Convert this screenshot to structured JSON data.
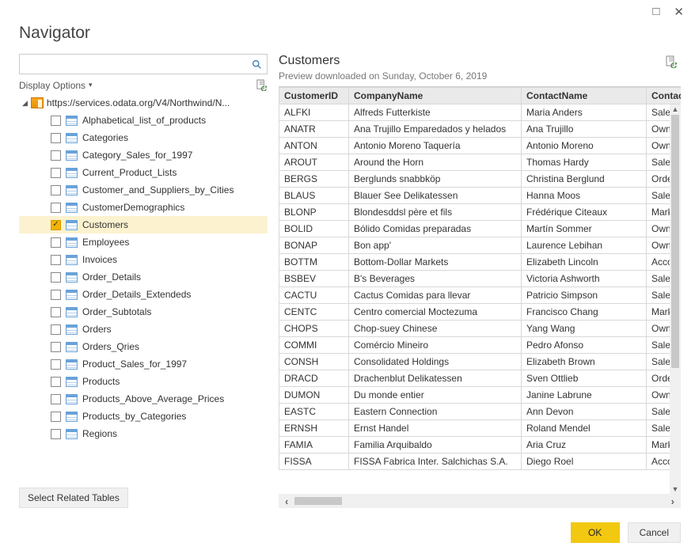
{
  "window": {
    "title": "Navigator"
  },
  "search": {
    "placeholder": ""
  },
  "displayOptions": {
    "label": "Display Options"
  },
  "tree": {
    "root": "https://services.odata.org/V4/Northwind/N...",
    "items": [
      {
        "label": "Alphabetical_list_of_products",
        "checked": false
      },
      {
        "label": "Categories",
        "checked": false
      },
      {
        "label": "Category_Sales_for_1997",
        "checked": false
      },
      {
        "label": "Current_Product_Lists",
        "checked": false
      },
      {
        "label": "Customer_and_Suppliers_by_Cities",
        "checked": false
      },
      {
        "label": "CustomerDemographics",
        "checked": false
      },
      {
        "label": "Customers",
        "checked": true
      },
      {
        "label": "Employees",
        "checked": false
      },
      {
        "label": "Invoices",
        "checked": false
      },
      {
        "label": "Order_Details",
        "checked": false
      },
      {
        "label": "Order_Details_Extendeds",
        "checked": false
      },
      {
        "label": "Order_Subtotals",
        "checked": false
      },
      {
        "label": "Orders",
        "checked": false
      },
      {
        "label": "Orders_Qries",
        "checked": false
      },
      {
        "label": "Product_Sales_for_1997",
        "checked": false
      },
      {
        "label": "Products",
        "checked": false
      },
      {
        "label": "Products_Above_Average_Prices",
        "checked": false
      },
      {
        "label": "Products_by_Categories",
        "checked": false
      },
      {
        "label": "Regions",
        "checked": false
      }
    ]
  },
  "selectRelated": "Select Related Tables",
  "preview": {
    "title": "Customers",
    "sub": "Preview downloaded on Sunday, October 6, 2019",
    "columns": [
      "CustomerID",
      "CompanyName",
      "ContactName",
      "ContactTi"
    ],
    "rows": [
      [
        "ALFKI",
        "Alfreds Futterkiste",
        "Maria Anders",
        "Sales "
      ],
      [
        "ANATR",
        "Ana Trujillo Emparedados y helados",
        "Ana Trujillo",
        "Owne"
      ],
      [
        "ANTON",
        "Antonio Moreno Taquería",
        "Antonio Moreno",
        "Owne"
      ],
      [
        "AROUT",
        "Around the Horn",
        "Thomas Hardy",
        "Sales "
      ],
      [
        "BERGS",
        "Berglunds snabbköp",
        "Christina Berglund",
        "Order"
      ],
      [
        "BLAUS",
        "Blauer See Delikatessen",
        "Hanna Moos",
        "Sales "
      ],
      [
        "BLONP",
        "Blondesddsl père et fils",
        "Frédérique Citeaux",
        "Marke"
      ],
      [
        "BOLID",
        "Bólido Comidas preparadas",
        "Martín Sommer",
        "Owne"
      ],
      [
        "BONAP",
        "Bon app'",
        "Laurence Lebihan",
        "Owne"
      ],
      [
        "BOTTM",
        "Bottom-Dollar Markets",
        "Elizabeth Lincoln",
        "Accou"
      ],
      [
        "BSBEV",
        "B's Beverages",
        "Victoria Ashworth",
        "Sales "
      ],
      [
        "CACTU",
        "Cactus Comidas para llevar",
        "Patricio Simpson",
        "Sales "
      ],
      [
        "CENTC",
        "Centro comercial Moctezuma",
        "Francisco Chang",
        "Marke"
      ],
      [
        "CHOPS",
        "Chop-suey Chinese",
        "Yang Wang",
        "Owne"
      ],
      [
        "COMMI",
        "Comércio Mineiro",
        "Pedro Afonso",
        "Sales "
      ],
      [
        "CONSH",
        "Consolidated Holdings",
        "Elizabeth Brown",
        "Sales "
      ],
      [
        "DRACD",
        "Drachenblut Delikatessen",
        "Sven Ottlieb",
        "Order"
      ],
      [
        "DUMON",
        "Du monde entier",
        "Janine Labrune",
        "Owne"
      ],
      [
        "EASTC",
        "Eastern Connection",
        "Ann Devon",
        "Sales "
      ],
      [
        "ERNSH",
        "Ernst Handel",
        "Roland Mendel",
        "Sales "
      ],
      [
        "FAMIA",
        "Familia Arquibaldo",
        "Aria Cruz",
        "Marke"
      ],
      [
        "FISSA",
        "FISSA Fabrica Inter. Salchichas S.A.",
        "Diego Roel",
        "Accou"
      ]
    ]
  },
  "buttons": {
    "ok": "OK",
    "cancel": "Cancel"
  }
}
